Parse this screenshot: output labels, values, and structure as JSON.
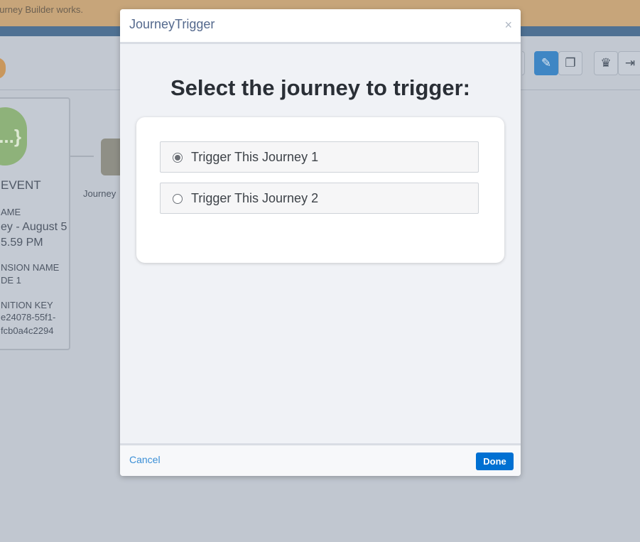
{
  "background": {
    "notice_text": "ourney Builder works.",
    "event_card": {
      "icon_text": "...}",
      "title": "EVENT",
      "name_label": "AME",
      "name_value_line1": "ey - August 5",
      "name_value_line2": "5.59 PM",
      "extension_label": "NSION NAME",
      "extension_value": "DE 1",
      "definition_label": "NITION KEY",
      "definition_line1": "e24078-55f1-",
      "definition_line2": "fcb0a4c2294"
    },
    "journey_label": "Journey"
  },
  "modal": {
    "title": "JourneyTrigger",
    "close_glyph": "×",
    "heading": "Select the journey to trigger:",
    "options": [
      {
        "label": "Trigger This Journey 1",
        "selected": true
      },
      {
        "label": "Trigger This Journey 2",
        "selected": false
      }
    ],
    "cancel_label": "Cancel",
    "done_label": "Done"
  },
  "colors": {
    "primary": "#0070d2",
    "link": "#3b8fd6",
    "active_tool": "#3f86c4"
  }
}
